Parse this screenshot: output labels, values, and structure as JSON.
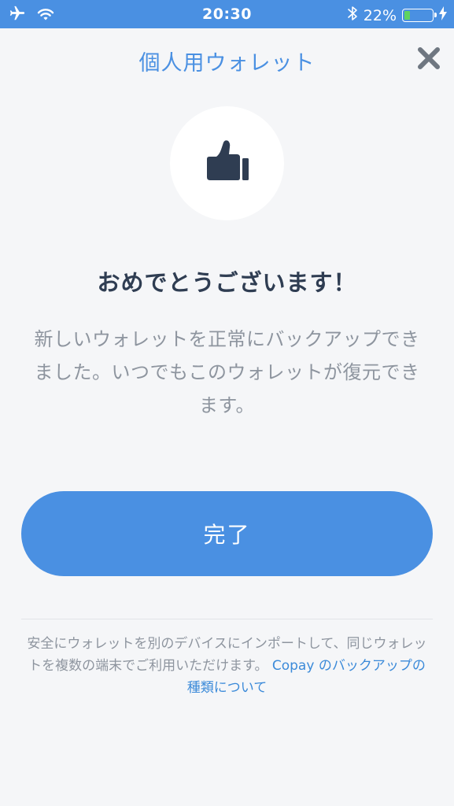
{
  "status_bar": {
    "time": "20:30",
    "battery_percent": "22%",
    "battery_level": 0.22,
    "bluetooth_icon": "bluetooth-icon",
    "airplane_icon": "airplane-icon",
    "wifi_icon": "wifi-icon",
    "charging_icon": "bolt-icon"
  },
  "header": {
    "title": "個人用ウォレット",
    "close_icon": "close-icon"
  },
  "hero": {
    "icon": "thumbs-up-icon"
  },
  "content": {
    "headline": "おめでとうございます！",
    "message": "新しいウォレットを正常にバックアップできました。いつでもこのウォレットが復元できます。"
  },
  "actions": {
    "done_label": "完了"
  },
  "footer": {
    "note": "安全にウォレットを別のデバイスにインポートして、同じウォレットを複数の端末でご利用いただけます。",
    "link_text": "Copay のバックアップの種類について"
  },
  "colors": {
    "accent": "#4a90e2",
    "background": "#f5f6f8",
    "headline": "#2f3d52",
    "muted_text": "#8e959f",
    "battery_fill": "#5fd35f"
  }
}
